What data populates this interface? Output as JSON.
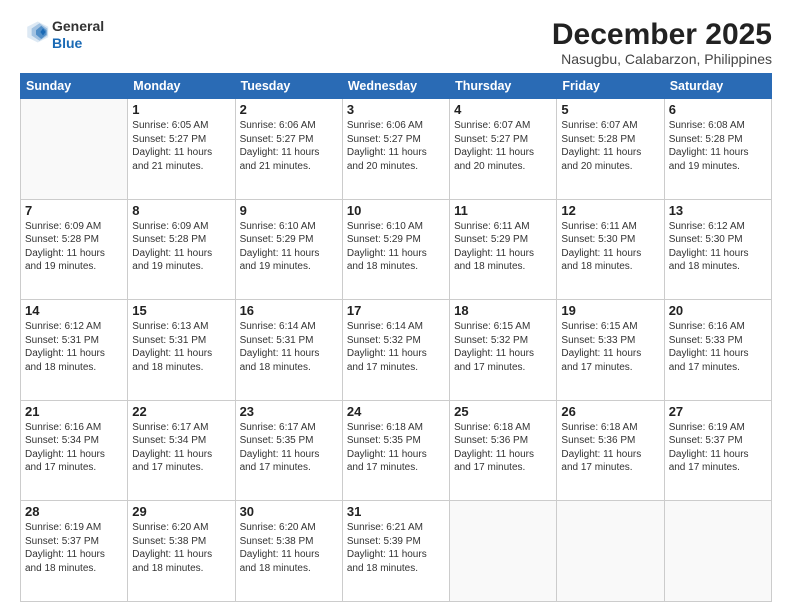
{
  "header": {
    "logo_general": "General",
    "logo_blue": "Blue",
    "month_title": "December 2025",
    "location": "Nasugbu, Calabarzon, Philippines"
  },
  "weekdays": [
    "Sunday",
    "Monday",
    "Tuesday",
    "Wednesday",
    "Thursday",
    "Friday",
    "Saturday"
  ],
  "weeks": [
    [
      {
        "day": "",
        "info": ""
      },
      {
        "day": "1",
        "info": "Sunrise: 6:05 AM\nSunset: 5:27 PM\nDaylight: 11 hours\nand 21 minutes."
      },
      {
        "day": "2",
        "info": "Sunrise: 6:06 AM\nSunset: 5:27 PM\nDaylight: 11 hours\nand 21 minutes."
      },
      {
        "day": "3",
        "info": "Sunrise: 6:06 AM\nSunset: 5:27 PM\nDaylight: 11 hours\nand 20 minutes."
      },
      {
        "day": "4",
        "info": "Sunrise: 6:07 AM\nSunset: 5:27 PM\nDaylight: 11 hours\nand 20 minutes."
      },
      {
        "day": "5",
        "info": "Sunrise: 6:07 AM\nSunset: 5:28 PM\nDaylight: 11 hours\nand 20 minutes."
      },
      {
        "day": "6",
        "info": "Sunrise: 6:08 AM\nSunset: 5:28 PM\nDaylight: 11 hours\nand 19 minutes."
      }
    ],
    [
      {
        "day": "7",
        "info": "Sunrise: 6:09 AM\nSunset: 5:28 PM\nDaylight: 11 hours\nand 19 minutes."
      },
      {
        "day": "8",
        "info": "Sunrise: 6:09 AM\nSunset: 5:28 PM\nDaylight: 11 hours\nand 19 minutes."
      },
      {
        "day": "9",
        "info": "Sunrise: 6:10 AM\nSunset: 5:29 PM\nDaylight: 11 hours\nand 19 minutes."
      },
      {
        "day": "10",
        "info": "Sunrise: 6:10 AM\nSunset: 5:29 PM\nDaylight: 11 hours\nand 18 minutes."
      },
      {
        "day": "11",
        "info": "Sunrise: 6:11 AM\nSunset: 5:29 PM\nDaylight: 11 hours\nand 18 minutes."
      },
      {
        "day": "12",
        "info": "Sunrise: 6:11 AM\nSunset: 5:30 PM\nDaylight: 11 hours\nand 18 minutes."
      },
      {
        "day": "13",
        "info": "Sunrise: 6:12 AM\nSunset: 5:30 PM\nDaylight: 11 hours\nand 18 minutes."
      }
    ],
    [
      {
        "day": "14",
        "info": "Sunrise: 6:12 AM\nSunset: 5:31 PM\nDaylight: 11 hours\nand 18 minutes."
      },
      {
        "day": "15",
        "info": "Sunrise: 6:13 AM\nSunset: 5:31 PM\nDaylight: 11 hours\nand 18 minutes."
      },
      {
        "day": "16",
        "info": "Sunrise: 6:14 AM\nSunset: 5:31 PM\nDaylight: 11 hours\nand 18 minutes."
      },
      {
        "day": "17",
        "info": "Sunrise: 6:14 AM\nSunset: 5:32 PM\nDaylight: 11 hours\nand 17 minutes."
      },
      {
        "day": "18",
        "info": "Sunrise: 6:15 AM\nSunset: 5:32 PM\nDaylight: 11 hours\nand 17 minutes."
      },
      {
        "day": "19",
        "info": "Sunrise: 6:15 AM\nSunset: 5:33 PM\nDaylight: 11 hours\nand 17 minutes."
      },
      {
        "day": "20",
        "info": "Sunrise: 6:16 AM\nSunset: 5:33 PM\nDaylight: 11 hours\nand 17 minutes."
      }
    ],
    [
      {
        "day": "21",
        "info": "Sunrise: 6:16 AM\nSunset: 5:34 PM\nDaylight: 11 hours\nand 17 minutes."
      },
      {
        "day": "22",
        "info": "Sunrise: 6:17 AM\nSunset: 5:34 PM\nDaylight: 11 hours\nand 17 minutes."
      },
      {
        "day": "23",
        "info": "Sunrise: 6:17 AM\nSunset: 5:35 PM\nDaylight: 11 hours\nand 17 minutes."
      },
      {
        "day": "24",
        "info": "Sunrise: 6:18 AM\nSunset: 5:35 PM\nDaylight: 11 hours\nand 17 minutes."
      },
      {
        "day": "25",
        "info": "Sunrise: 6:18 AM\nSunset: 5:36 PM\nDaylight: 11 hours\nand 17 minutes."
      },
      {
        "day": "26",
        "info": "Sunrise: 6:18 AM\nSunset: 5:36 PM\nDaylight: 11 hours\nand 17 minutes."
      },
      {
        "day": "27",
        "info": "Sunrise: 6:19 AM\nSunset: 5:37 PM\nDaylight: 11 hours\nand 17 minutes."
      }
    ],
    [
      {
        "day": "28",
        "info": "Sunrise: 6:19 AM\nSunset: 5:37 PM\nDaylight: 11 hours\nand 18 minutes."
      },
      {
        "day": "29",
        "info": "Sunrise: 6:20 AM\nSunset: 5:38 PM\nDaylight: 11 hours\nand 18 minutes."
      },
      {
        "day": "30",
        "info": "Sunrise: 6:20 AM\nSunset: 5:38 PM\nDaylight: 11 hours\nand 18 minutes."
      },
      {
        "day": "31",
        "info": "Sunrise: 6:21 AM\nSunset: 5:39 PM\nDaylight: 11 hours\nand 18 minutes."
      },
      {
        "day": "",
        "info": ""
      },
      {
        "day": "",
        "info": ""
      },
      {
        "day": "",
        "info": ""
      }
    ]
  ]
}
